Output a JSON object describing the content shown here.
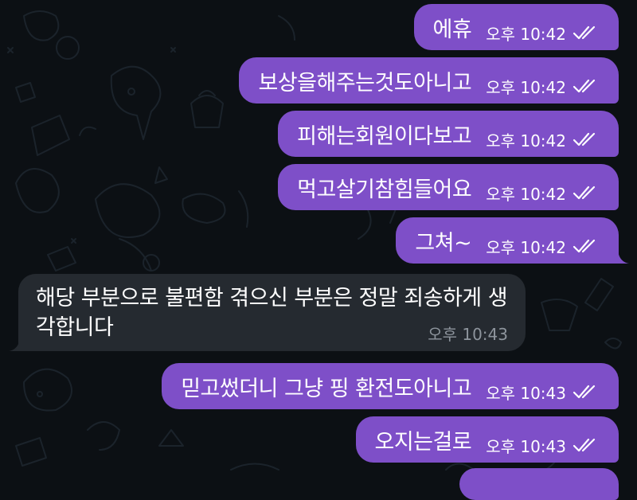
{
  "colors": {
    "background": "#0c1014",
    "outgoing_bubble": "#7e4fc8",
    "incoming_bubble": "#252a30",
    "incoming_time": "#8d949c"
  },
  "messages": [
    {
      "direction": "out",
      "text": "에휴",
      "time": "오후 10:42",
      "status": "read",
      "status_icon": "double-check-icon"
    },
    {
      "direction": "out",
      "text": "보상을해주는것도아니고",
      "time": "오후 10:42",
      "status": "read",
      "status_icon": "double-check-icon"
    },
    {
      "direction": "out",
      "text": "피해는회원이다보고",
      "time": "오후 10:42",
      "status": "read",
      "status_icon": "double-check-icon"
    },
    {
      "direction": "out",
      "text": "먹고살기참힘들어요",
      "time": "오후 10:42",
      "status": "read",
      "status_icon": "double-check-icon"
    },
    {
      "direction": "out",
      "text": "그쳐~",
      "time": "오후 10:42",
      "status": "read",
      "status_icon": "double-check-icon"
    },
    {
      "direction": "in",
      "text": "해당 부분으로 불편함 겪으신 부분은 정말 죄송하게 생각합니다",
      "time": "오후 10:43"
    },
    {
      "direction": "out",
      "text": "믿고썼더니 그냥 핑 환전도아니고",
      "time": "오후 10:43",
      "status": "read",
      "status_icon": "double-check-icon"
    },
    {
      "direction": "out",
      "text": "오지는걸로",
      "time": "오후 10:43",
      "status": "read",
      "status_icon": "double-check-icon"
    }
  ]
}
